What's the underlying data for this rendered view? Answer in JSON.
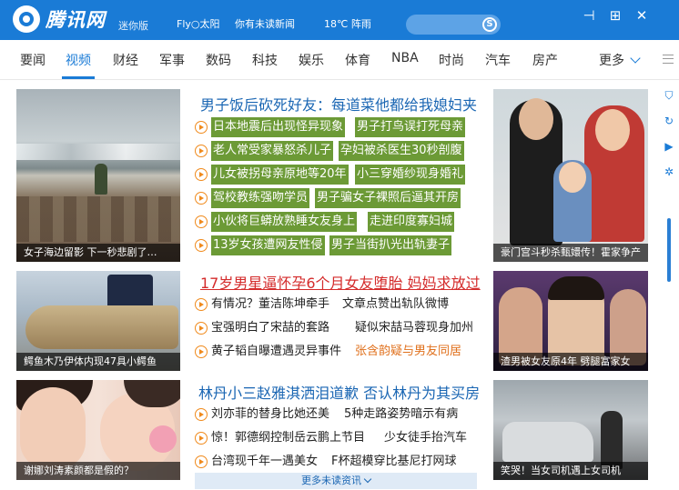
{
  "app": {
    "logo_text": "腾讯网",
    "mini_label": "迷你版",
    "weather_city": "Fly○太阳",
    "unread_news": "你有未读新闻",
    "temperature": "18℃ 阵雨",
    "search_glyph": "S",
    "window_buttons": [
      "pin-icon",
      "maximize-icon",
      "close-icon"
    ]
  },
  "nav": {
    "items": [
      "要闻",
      "视频",
      "财经",
      "军事",
      "数码",
      "科技",
      "娱乐",
      "体育",
      "NBA",
      "时尚",
      "汽车",
      "房产"
    ],
    "active_index": 1,
    "more_label": "更多"
  },
  "sections": [
    {
      "image_caption": "女子海边留影 下一秒悲剧了…",
      "headline": "男子饭后砍死好友：每道菜他都给我媳妇夹",
      "headline_color": "blue",
      "items": [
        {
          "text": "日本地震后出现怪异现象",
          "extra": "男子打鸟误打死母亲",
          "highlight": true
        },
        {
          "text": "老人常受家暴怒杀儿子",
          "extra": "孕妇被杀医生30秒剖腹",
          "highlight": true
        },
        {
          "text": "儿女被拐母亲原地等20年",
          "extra": "小三穿婚纱现身婚礼",
          "highlight": true
        },
        {
          "text": "驾校教练强吻学员",
          "extra": "男子骗女子裸照后逼其开房",
          "highlight": true
        },
        {
          "text": "小伙将巨蟒放熟睡女友身上",
          "extra": "走进印度寡妇城",
          "highlight": true
        },
        {
          "text": "13岁女孩遭网友性侵",
          "extra": "男子当街扒光出轨妻子",
          "highlight": true
        }
      ],
      "right_caption": "豪门宫斗秒杀甄嬛传！霍家争产"
    },
    {
      "image_caption": "鳄鱼木乃伊体内现47具小鳄鱼",
      "headline": "17岁男星逼怀孕6个月女友堕胎 妈妈求放过",
      "headline_color": "red",
      "items": [
        {
          "text": "有情况？董洁陈坤牵手",
          "extra": "文章点赞出轨队微博",
          "extra_color": "normal"
        },
        {
          "text": "宝强明白了宋喆的套路",
          "extra": "疑似宋喆马蓉现身加州",
          "extra_color": "normal"
        },
        {
          "text": "黄子韬自曝遭遇灵异事件",
          "extra": "张含韵疑与男友同居",
          "extra_color": "orange"
        }
      ],
      "right_caption": "渣男被女友原4年 劈腿富家女"
    },
    {
      "image_caption": "谢娜刘涛素颜都是假的？",
      "headline": "林丹小三赵雅淇洒泪道歉 否认林丹为其买房",
      "headline_color": "blue",
      "items": [
        {
          "text": "刘亦菲的替身比她还美",
          "extra": "5种走路姿势暗示有病",
          "extra_color": "normal"
        },
        {
          "text": "惊！郭德纲控制岳云鹏上节目",
          "extra": "少女徒手抬汽车",
          "extra_color": "normal"
        },
        {
          "text": "台湾现千年一遇美女",
          "extra": "F杯超模穿比基尼打网球",
          "extra_color": "normal"
        }
      ],
      "right_caption": "笑哭！当女司机遇上女司机"
    }
  ],
  "footer": {
    "more_news": "更多未读资讯"
  },
  "rail_icons": [
    "shield-icon",
    "refresh-icon",
    "play-icon",
    "settings-icon"
  ],
  "colors": {
    "brand_blue": "#1a7bd6",
    "highlight_green": "#6c9a36",
    "accent_orange": "#f08a1c",
    "headline_red": "#d42b2b"
  }
}
